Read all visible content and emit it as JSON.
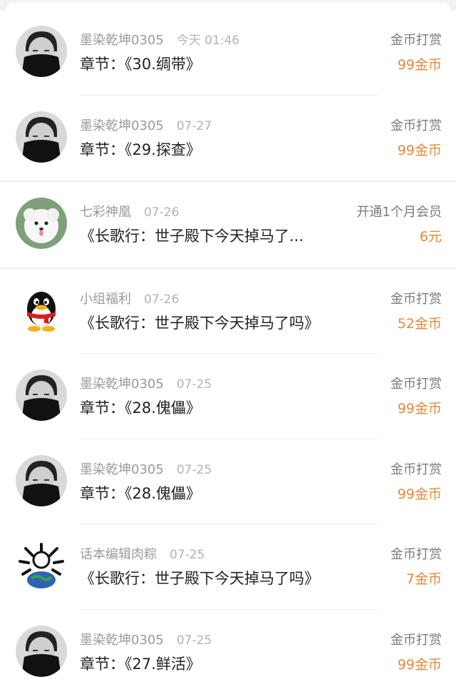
{
  "rewards": [
    {
      "user": "墨染乾坤0305",
      "date": "今天 01:46",
      "title": "章节：《30.绸带》",
      "type": "金币打赏",
      "amount": "99金币",
      "avatar": "portrait-avatar"
    },
    {
      "user": "墨染乾坤0305",
      "date": "07-27",
      "title": "章节：《29.探查》",
      "type": "金币打赏",
      "amount": "99金币",
      "avatar": "portrait-avatar"
    },
    {
      "user": "七彩神凰",
      "date": "07-26",
      "title": "《长歌行：世子殿下今天掉马了...",
      "type": "开通1个月会员",
      "amount": "6元",
      "avatar": "white-dog-avatar"
    },
    {
      "user": "小组福利",
      "date": "07-26",
      "title": "《长歌行：世子殿下今天掉马了吗》",
      "type": "金币打赏",
      "amount": "52金币",
      "avatar": "penguin-avatar"
    },
    {
      "user": "墨染乾坤0305",
      "date": "07-25",
      "title": "章节：《28.傀儡》",
      "type": "金币打赏",
      "amount": "99金币",
      "avatar": "portrait-avatar"
    },
    {
      "user": "墨染乾坤0305",
      "date": "07-25",
      "title": "章节：《28.傀儡》",
      "type": "金币打赏",
      "amount": "99金币",
      "avatar": "portrait-avatar"
    },
    {
      "user": "话本编辑肉粽",
      "date": "07-25",
      "title": "《长歌行：世子殿下今天掉马了吗》",
      "type": "金币打赏",
      "amount": "7金币",
      "avatar": "globe-avatar"
    },
    {
      "user": "墨染乾坤0305",
      "date": "07-25",
      "title": "章节：《27.鲜活》",
      "type": "金币打赏",
      "amount": "99金币",
      "avatar": "portrait-avatar"
    }
  ],
  "colors": {
    "amount": "#e08a3c",
    "meta": "#9a9a9a",
    "title": "#222222"
  }
}
